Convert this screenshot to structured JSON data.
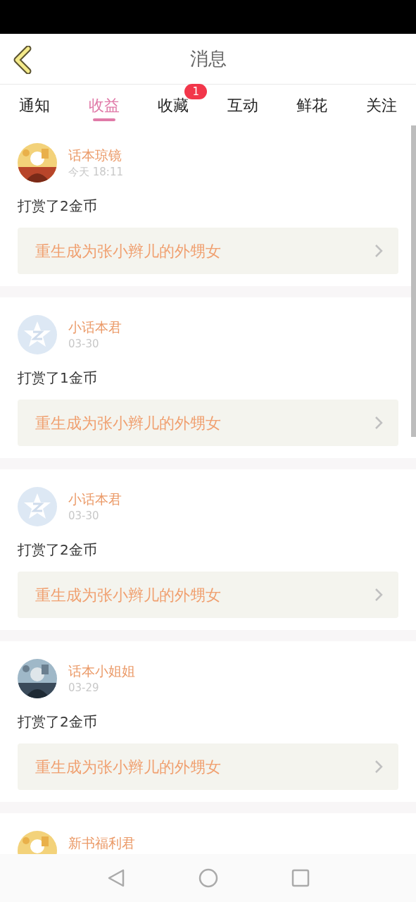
{
  "header": {
    "title": "消息"
  },
  "tabs": [
    {
      "label": "通知",
      "selected": false
    },
    {
      "label": "收益",
      "selected": true
    },
    {
      "label": "收藏",
      "selected": false,
      "badge": "1"
    },
    {
      "label": "互动",
      "selected": false
    },
    {
      "label": "鲜花",
      "selected": false
    },
    {
      "label": "关注",
      "selected": false
    }
  ],
  "messages": [
    {
      "name": "话本琼镜",
      "time": "今天 18:11",
      "text": "打赏了2金币",
      "book": "重生成为张小辫儿的外甥女"
    },
    {
      "avatar": {
        "kind": "default"
      },
      "name": "小话本君",
      "time": "03-30",
      "text": "打赏了1金币",
      "book": "重生成为张小辫儿的外甥女"
    },
    {
      "avatar": {
        "kind": "default"
      },
      "name": "小话本君",
      "time": "03-30",
      "text": "打赏了2金币",
      "book": "重生成为张小辫儿的外甥女"
    },
    {
      "name": "话本小姐姐",
      "time": "03-29",
      "text": "打赏了2金币",
      "book": "重生成为张小辫儿的外甥女"
    },
    {
      "name": "新书福利君"
    }
  ]
}
